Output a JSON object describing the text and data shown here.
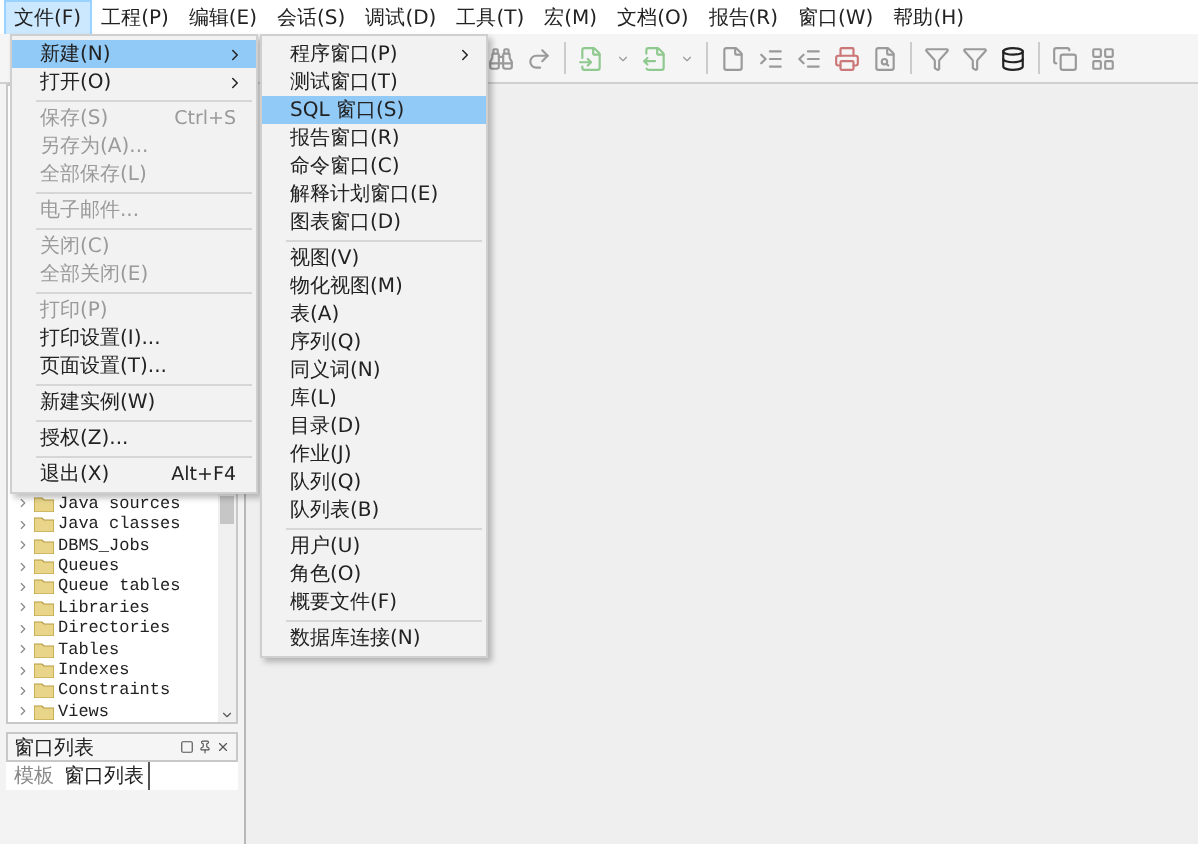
{
  "menubar": [
    {
      "label": "文件(F)",
      "selected": true
    },
    {
      "label": "工程(P)",
      "selected": false
    },
    {
      "label": "编辑(E)",
      "selected": false
    },
    {
      "label": "会话(S)",
      "selected": false
    },
    {
      "label": "调试(D)",
      "selected": false
    },
    {
      "label": "工具(T)",
      "selected": false
    },
    {
      "label": "宏(M)",
      "selected": false
    },
    {
      "label": "文档(O)",
      "selected": false
    },
    {
      "label": "报告(R)",
      "selected": false
    },
    {
      "label": "窗口(W)",
      "selected": false
    },
    {
      "label": "帮助(H)",
      "selected": false
    }
  ],
  "file_menu": [
    {
      "kind": "item",
      "label": "新建(N)",
      "submenu": true,
      "selected": true,
      "disabled": false
    },
    {
      "kind": "item",
      "label": "打开(O)",
      "submenu": true,
      "selected": false,
      "disabled": false
    },
    {
      "kind": "separator"
    },
    {
      "kind": "item",
      "label": "保存(S)",
      "shortcut": "Ctrl+S",
      "selected": false,
      "disabled": true
    },
    {
      "kind": "item",
      "label": "另存为(A)...",
      "selected": false,
      "disabled": true
    },
    {
      "kind": "item",
      "label": "全部保存(L)",
      "selected": false,
      "disabled": true
    },
    {
      "kind": "separator"
    },
    {
      "kind": "item",
      "label": "电子邮件...",
      "selected": false,
      "disabled": true
    },
    {
      "kind": "separator"
    },
    {
      "kind": "item",
      "label": "关闭(C)",
      "selected": false,
      "disabled": true
    },
    {
      "kind": "item",
      "label": "全部关闭(E)",
      "selected": false,
      "disabled": true
    },
    {
      "kind": "separator"
    },
    {
      "kind": "item",
      "label": "打印(P)",
      "selected": false,
      "disabled": true
    },
    {
      "kind": "item",
      "label": "打印设置(I)...",
      "selected": false,
      "disabled": false
    },
    {
      "kind": "item",
      "label": "页面设置(T)...",
      "selected": false,
      "disabled": false
    },
    {
      "kind": "separator"
    },
    {
      "kind": "item",
      "label": "新建实例(W)",
      "selected": false,
      "disabled": false
    },
    {
      "kind": "separator"
    },
    {
      "kind": "item",
      "label": "授权(Z)...",
      "selected": false,
      "disabled": false
    },
    {
      "kind": "separator"
    },
    {
      "kind": "item",
      "label": "退出(X)",
      "shortcut": "Alt+F4",
      "selected": false,
      "disabled": false
    }
  ],
  "new_submenu": [
    {
      "kind": "item",
      "label": "程序窗口(P)",
      "submenu": true,
      "selected": false
    },
    {
      "kind": "item",
      "label": "测试窗口(T)",
      "selected": false
    },
    {
      "kind": "item",
      "label": "SQL 窗口(S)",
      "selected": true
    },
    {
      "kind": "item",
      "label": "报告窗口(R)",
      "selected": false
    },
    {
      "kind": "item",
      "label": "命令窗口(C)",
      "selected": false
    },
    {
      "kind": "item",
      "label": "解释计划窗口(E)",
      "selected": false
    },
    {
      "kind": "item",
      "label": "图表窗口(D)",
      "selected": false
    },
    {
      "kind": "separator"
    },
    {
      "kind": "item",
      "label": "视图(V)",
      "selected": false
    },
    {
      "kind": "item",
      "label": "物化视图(M)",
      "selected": false
    },
    {
      "kind": "item",
      "label": "表(A)",
      "selected": false
    },
    {
      "kind": "item",
      "label": "序列(Q)",
      "selected": false
    },
    {
      "kind": "item",
      "label": "同义词(N)",
      "selected": false
    },
    {
      "kind": "item",
      "label": "库(L)",
      "selected": false
    },
    {
      "kind": "item",
      "label": "目录(D)",
      "selected": false
    },
    {
      "kind": "item",
      "label": "作业(J)",
      "selected": false
    },
    {
      "kind": "item",
      "label": "队列(Q)",
      "selected": false
    },
    {
      "kind": "item",
      "label": "队列表(B)",
      "selected": false
    },
    {
      "kind": "separator"
    },
    {
      "kind": "item",
      "label": "用户(U)",
      "selected": false
    },
    {
      "kind": "item",
      "label": "角色(O)",
      "selected": false
    },
    {
      "kind": "item",
      "label": "概要文件(F)",
      "selected": false
    },
    {
      "kind": "separator"
    },
    {
      "kind": "item",
      "label": "数据库连接(N)",
      "selected": false
    }
  ],
  "object_tree": {
    "items": [
      {
        "label": "Java sources"
      },
      {
        "label": "Java classes"
      },
      {
        "label": "DBMS_Jobs"
      },
      {
        "label": "Queues"
      },
      {
        "label": "Queue tables"
      },
      {
        "label": "Libraries"
      },
      {
        "label": "Directories"
      },
      {
        "label": "Tables"
      },
      {
        "label": "Indexes"
      },
      {
        "label": "Constraints"
      },
      {
        "label": "Views"
      }
    ]
  },
  "window_list_panel": {
    "title": "窗口列表",
    "tabs": [
      {
        "label": "模板",
        "selected": false
      },
      {
        "label": "窗口列表",
        "selected": true
      }
    ]
  }
}
